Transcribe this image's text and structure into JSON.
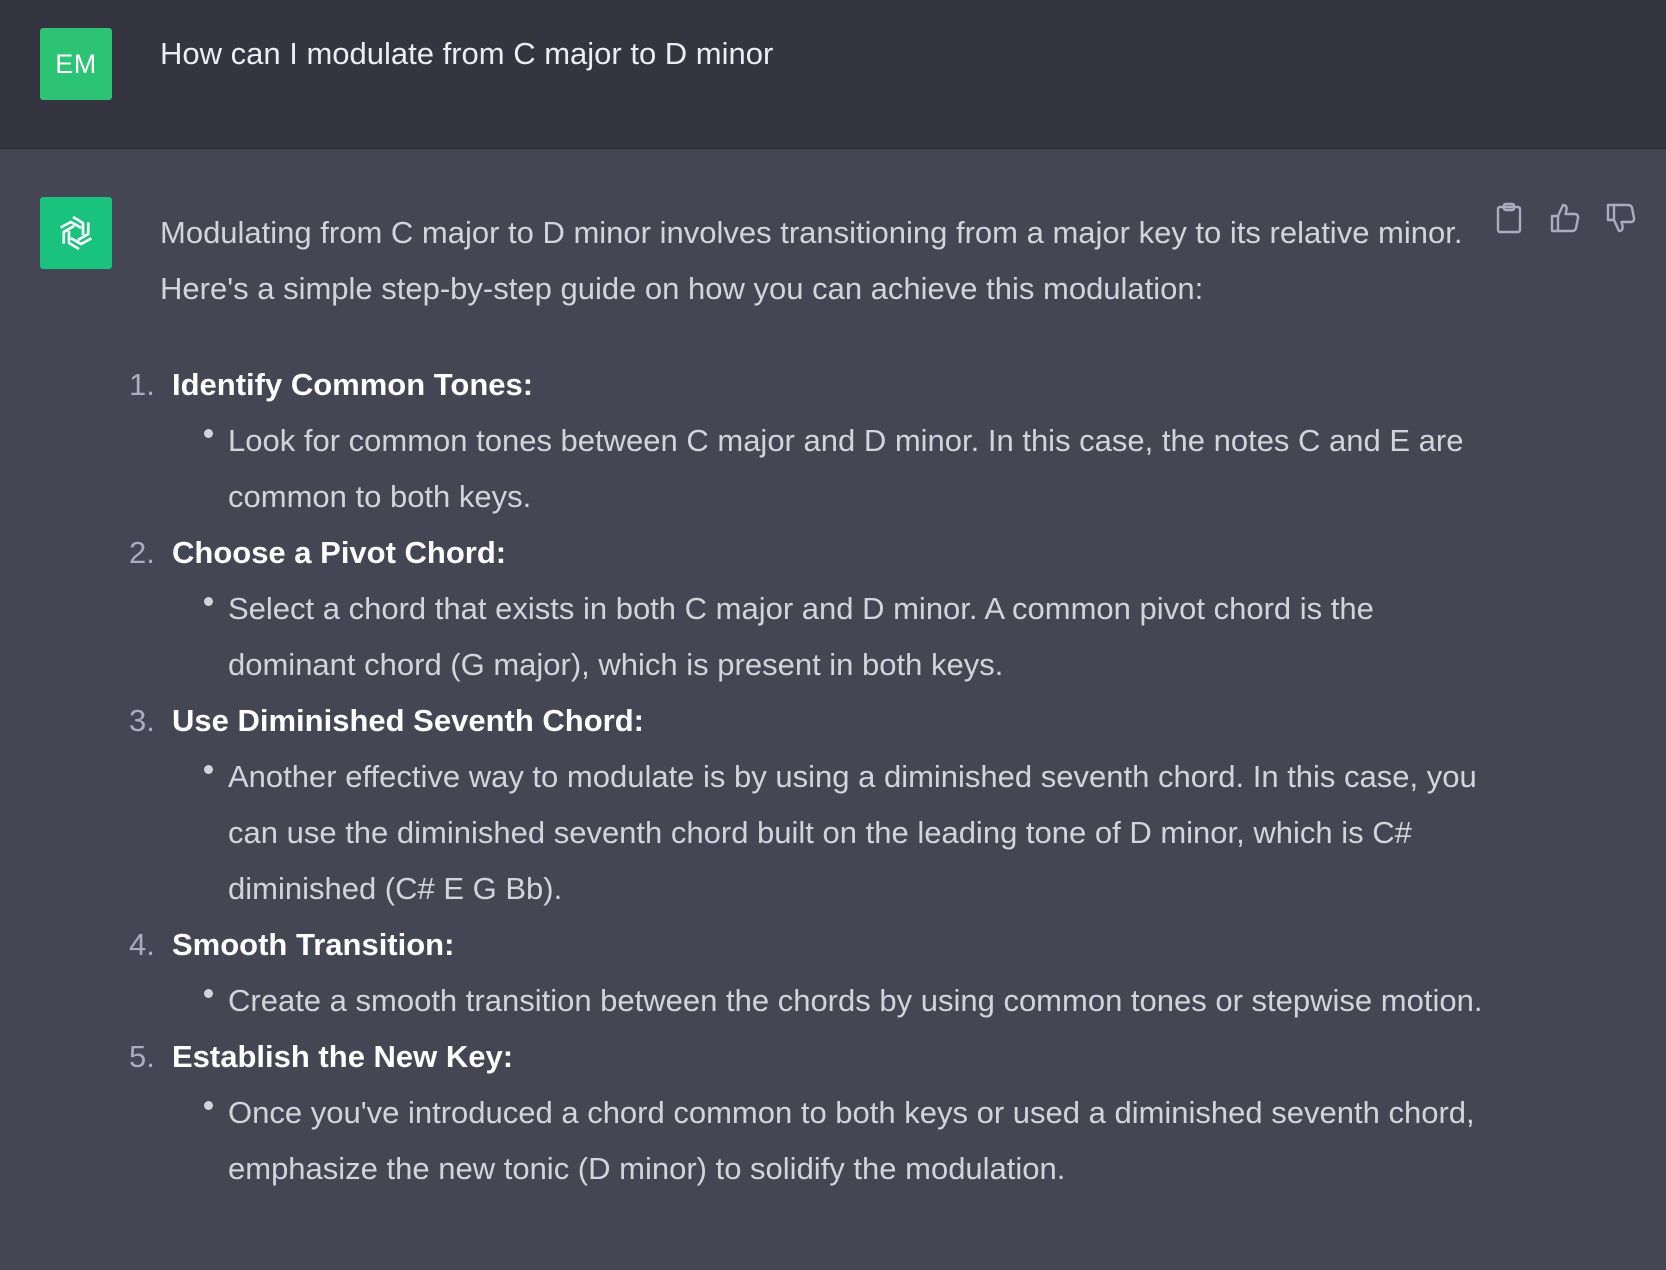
{
  "user_message": {
    "avatar_initials": "EM",
    "text": "How can I modulate from C major to D minor"
  },
  "assistant_message": {
    "avatar_icon": "openai-logo-icon",
    "actions": [
      {
        "name": "copy-button",
        "icon": "clipboard-icon"
      },
      {
        "name": "thumbs-up-button",
        "icon": "thumbs-up-icon"
      },
      {
        "name": "thumbs-down-button",
        "icon": "thumbs-down-icon"
      }
    ],
    "intro": "Modulating from C major to D minor involves transitioning from a major key to its relative minor. Here's a simple step-by-step guide on how you can achieve this modulation:",
    "steps": [
      {
        "number": "1.",
        "title": "Identify Common Tones:",
        "detail": "Look for common tones between C major and D minor. In this case, the notes C and E are common to both keys."
      },
      {
        "number": "2.",
        "title": "Choose a Pivot Chord:",
        "detail": "Select a chord that exists in both C major and D minor. A common pivot chord is the dominant chord (G major), which is present in both keys."
      },
      {
        "number": "3.",
        "title": "Use Diminished Seventh Chord:",
        "detail": "Another effective way to modulate is by using a diminished seventh chord. In this case, you can use the diminished seventh chord built on the leading tone of D minor, which is C# diminished (C# E G Bb)."
      },
      {
        "number": "4.",
        "title": "Smooth Transition:",
        "detail": "Create a smooth transition between the chords by using common tones or stepwise motion."
      },
      {
        "number": "5.",
        "title": "Establish the New Key:",
        "detail": "Once you've introduced a chord common to both keys or used a diminished seventh chord, emphasize the new tonic (D minor) to solidify the modulation."
      }
    ]
  },
  "colors": {
    "user_bg": "#343541",
    "assistant_bg": "#444654",
    "user_avatar": "#2dc374",
    "gpt_avatar": "#19c37d",
    "text": "#d1d5db",
    "heading": "#ffffff"
  }
}
